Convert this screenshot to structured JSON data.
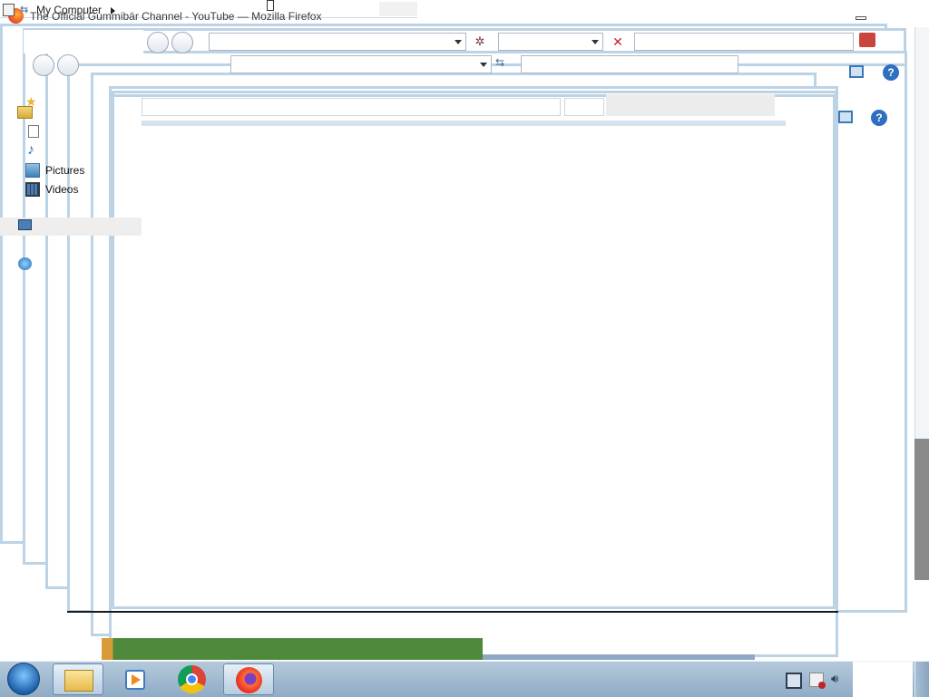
{
  "windows": {
    "firefox": {
      "title": "The Official Gummibär Channel - YouTube — Mozilla Firefox"
    },
    "explorer": {
      "address_crumb": "My Computer",
      "nav_items": [
        {
          "label": "Pictures",
          "icon": "pictures-folder-icon"
        },
        {
          "label": "Videos",
          "icon": "videos-folder-icon"
        }
      ],
      "toolbar_icons": [
        "preview-pane-icon",
        "help-icon"
      ],
      "help_glyph": "?"
    }
  },
  "taskbar": {
    "start_icon": "windows-start-orb",
    "pinned": [
      {
        "name": "file-explorer-icon",
        "active": true
      },
      {
        "name": "media-player-icon",
        "active": false
      },
      {
        "name": "chrome-icon",
        "active": false
      },
      {
        "name": "firefox-icon",
        "active": true
      }
    ],
    "tray_icons": [
      "network-icon",
      "action-center-icon",
      "volume-icon"
    ]
  },
  "colors": {
    "frame_border": "#bcd3e6",
    "taskbar_top": "#b5c9db",
    "taskbar_bottom": "#8fabc6",
    "help_blue": "#2f6fc0"
  }
}
